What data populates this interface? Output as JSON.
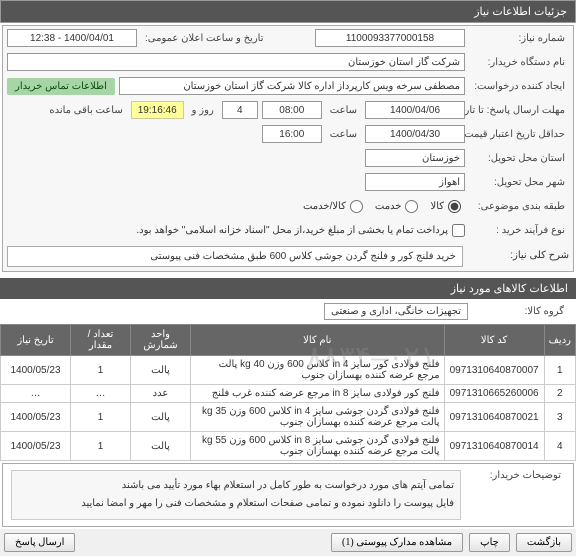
{
  "header": {
    "title": "جزئیات اطلاعات نیاز"
  },
  "form": {
    "need_no_label": "شماره نیاز:",
    "need_no": "1100093377000158",
    "announce_label": "تاریخ و ساعت اعلان عمومی:",
    "announce_value": "1400/04/01 - 12:38",
    "org_label": "نام دستگاه خریدار:",
    "org_value": "شرکت گاز استان خوزستان",
    "creator_label": "ایجاد کننده درخواست:",
    "creator_value": "مصطفی  سرخه ویس کارپرداز اداره کالا شرکت گاز استان خوزستان",
    "contact_btn": "اطلاعات تماس خریدار",
    "deadline_label": "مهلت ارسال پاسخ: تا تاریخ:",
    "deadline_date": "1400/04/06",
    "deadline_time_label": "ساعت",
    "deadline_time": "08:00",
    "remain_days": "4",
    "remain_days_label": "روز و",
    "remain_time": "19:16:46",
    "remain_suffix": "ساعت باقی مانده",
    "validity_label": "حداقل تاریخ اعتبار قیمت: تا تاریخ:",
    "validity_date": "1400/04/30",
    "validity_time_label": "ساعت",
    "validity_time": "16:00",
    "province_label": "استان محل تحویل:",
    "province_value": "خوزستان",
    "city_label": "شهر محل تحویل:",
    "city_value": "اهواز",
    "budget_label": "طبقه بندی موضوعی:",
    "budget_opts": [
      "کالا",
      "خدمت",
      "کالا/خدمت"
    ],
    "process_label": "نوع فرآیند خرید :",
    "process_note": "پرداخت تمام یا بخشی از مبلغ خرید،از محل \"اسناد خزانه اسلامی\" خواهد بود.",
    "summary_label": "شرح کلی نیاز:",
    "summary_value": "خرید فلنج کور و فلنج گردن جوشی کلاس 600 طبق مشخصات فنی پیوستی"
  },
  "items_section": {
    "title": "اطلاعات کالاهای مورد نیاز",
    "group_label": "گروه کالا:",
    "group_value": "تجهیزات خانگی، اداری و صنعتی"
  },
  "table": {
    "headers": [
      "ردیف",
      "کد کالا",
      "نام کالا",
      "واحد شمارش",
      "تعداد / مقدار",
      "تاریخ نیاز"
    ],
    "rows": [
      {
        "idx": "1",
        "code": "0971310640870007",
        "name": "فلنج فولادی کور سایز 4 in کلاس 600 وزن 40 kg پالت مرجع عرضه کننده بهسازان جنوب",
        "unit": "پالت",
        "qty": "1",
        "date": "1400/05/23"
      },
      {
        "idx": "2",
        "code": "0971310665260006",
        "name": "فلنج کور فولادی سایز 8 in مرجع عرضه کننده غرب فلنج",
        "unit": "عدد",
        "qty": "…",
        "date": "…"
      },
      {
        "idx": "3",
        "code": "0971310640870021",
        "name": "فلنج فولادی گردن جوشی سایز 4 in کلاس 600 وزن 35 kg پالت مرجع عرضه کننده بهسازان جنوب",
        "unit": "پالت",
        "qty": "1",
        "date": "1400/05/23"
      },
      {
        "idx": "4",
        "code": "0971310640870014",
        "name": "فلنج فولادی گردن جوشی سایز 8 in کلاس 600 وزن 55 kg پالت مرجع عرضه کننده بهسازان جنوب",
        "unit": "پالت",
        "qty": "1",
        "date": "1400/05/23"
      }
    ]
  },
  "buyer_note": {
    "label": "توضیحات خریدار:",
    "line1": "تمامی آیتم های مورد درخواست به طور کامل در استعلام بهاء مورد تأیید می باشند",
    "line2": "فایل پیوست را دانلود نموده و تمامی صفحات استعلام و مشخصات فنی را مهر و امضا نمایید"
  },
  "footer": {
    "back": "بازگشت",
    "print": "چاپ",
    "attachments": "مشاهده مدارک پیوستی (1)",
    "reply": "ارسال پاسخ"
  },
  "watermark": "۰۲۱–۸۸۳۴…"
}
